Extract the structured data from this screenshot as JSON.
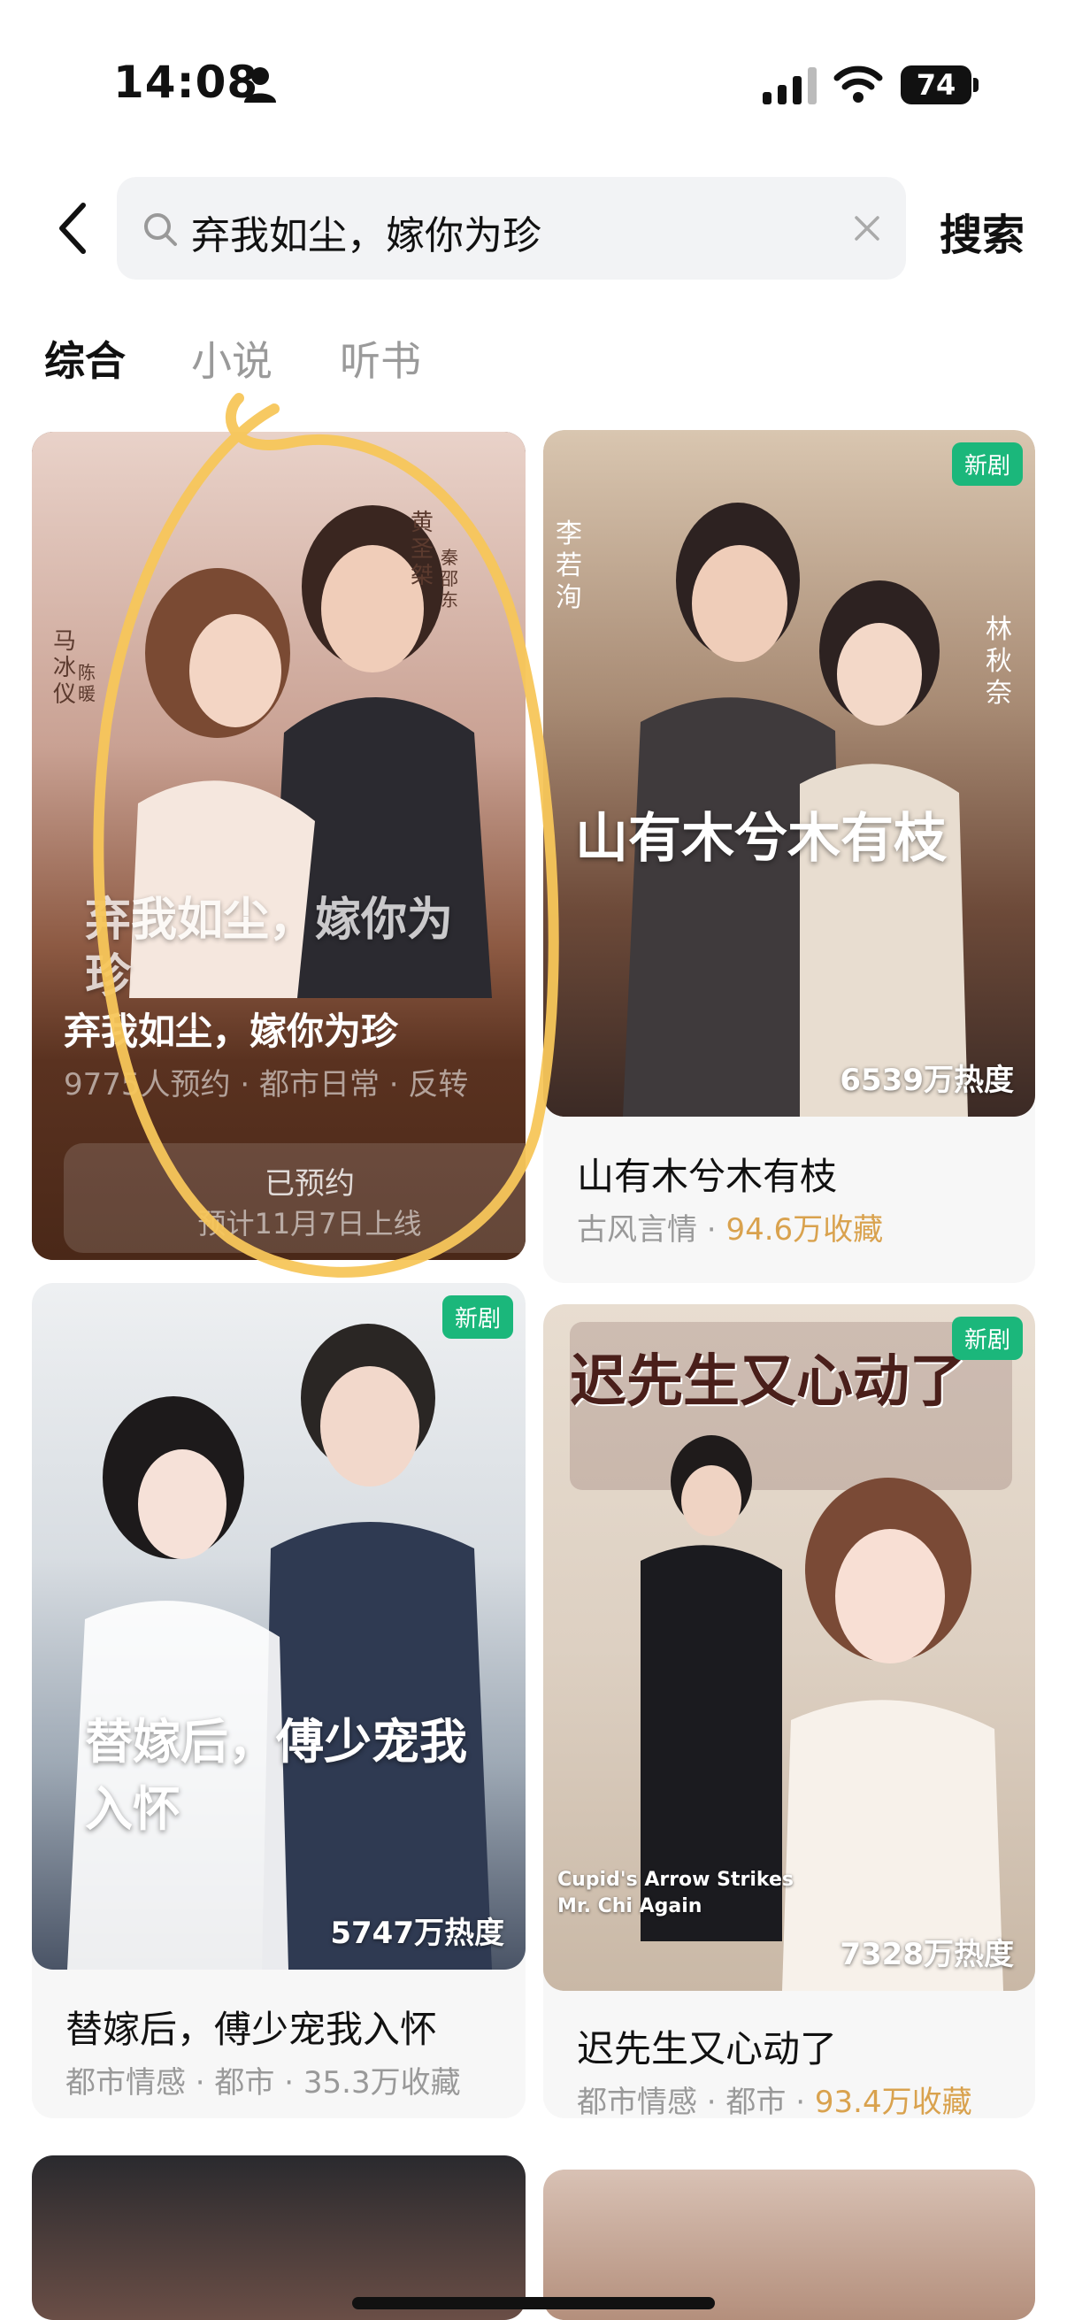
{
  "status_bar": {
    "time": "14:08",
    "battery": "74"
  },
  "search": {
    "query": "弃我如尘，嫁你为珍",
    "button_label": "搜索"
  },
  "tabs": [
    {
      "label": "综合",
      "active": true
    },
    {
      "label": "小说",
      "active": false
    },
    {
      "label": "听书",
      "active": false
    }
  ],
  "featured": {
    "title": "弃我如尘，嫁你为珍",
    "meta": "9775人预约 · 都市日常 · 反转",
    "reserve_label": "已预约",
    "reserve_sub": "预计11月7日上线",
    "poster_text": "弃我如尘，嫁你为珍",
    "cast": [
      "黄圣桀",
      "秦邵东",
      "马冰仪",
      "陈暖"
    ]
  },
  "cards": [
    {
      "title": "山有木兮木有枝",
      "genre": "古风言情",
      "favorites": "94.6万收藏",
      "heat": "6539万热度",
      "badge": "新剧",
      "poster_text": "山有木兮木有枝",
      "cast": [
        "李若洵",
        "林秋奈"
      ]
    },
    {
      "title": "替嫁后，傅少宠我入怀",
      "genre": "都市情感 · 都市",
      "favorites": "35.3万收藏",
      "heat": "5747万热度",
      "badge": "新剧",
      "poster_text": "替嫁后，傅少宠我入怀"
    },
    {
      "title": "迟先生又心动了",
      "genre": "都市情感 · 都市",
      "favorites": "93.4万收藏",
      "heat": "7328万热度",
      "badge": "新剧",
      "poster_text": "迟先生又心动了",
      "poster_subtitle": "Cupid's Arrow Strikes Mr. Chi Again"
    }
  ],
  "colors": {
    "accent_green": "#1bb77b",
    "favorite_gold": "#d9a24e",
    "highlight_yellow": "#f7c65a"
  }
}
